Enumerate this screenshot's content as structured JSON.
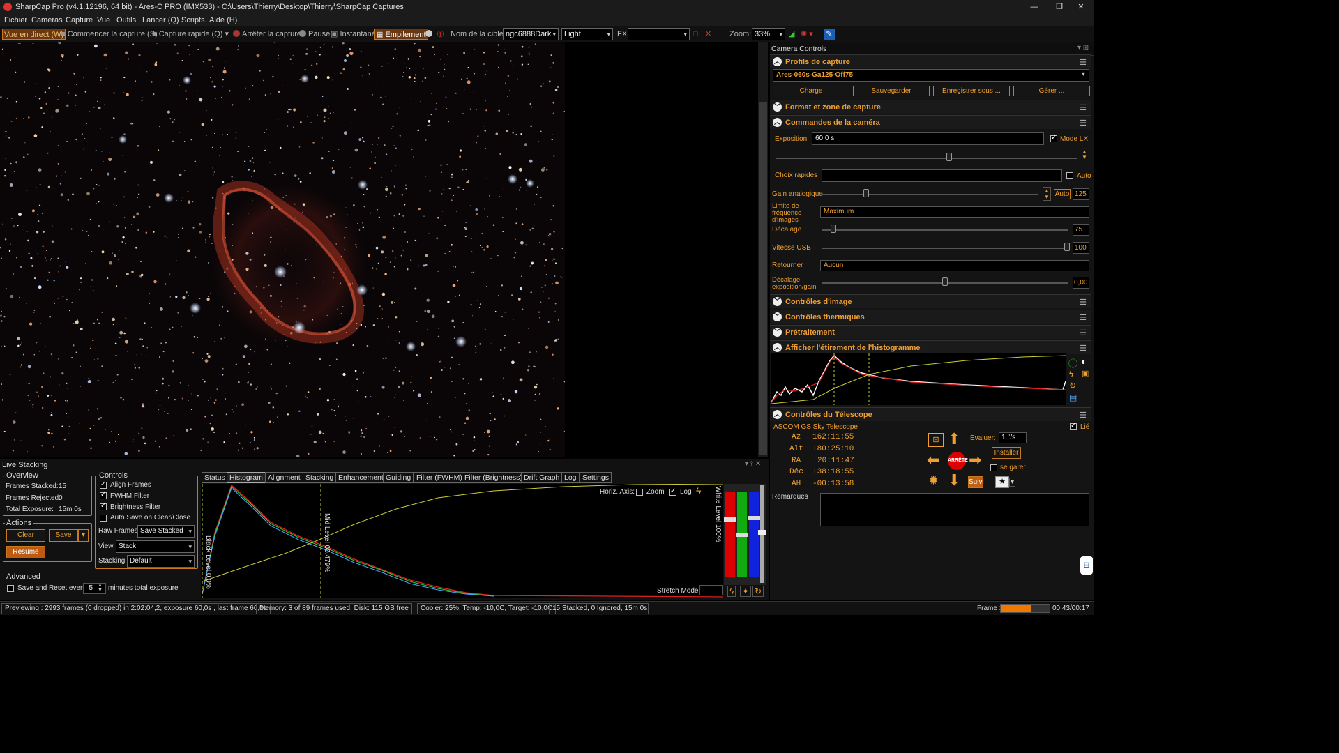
{
  "window": {
    "title": "SharpCap Pro (v4.1.12196, 64 bit) - Ares-C PRO (IMX533)  - C:\\Users\\Thierry\\Desktop\\Thierry\\SharpCap Captures"
  },
  "menu": [
    "Fichier",
    "Cameras",
    "Capture",
    "Vue",
    "Outils",
    "Lancer (Q)",
    "Scripts",
    "Aide (H)"
  ],
  "toolbar": {
    "live_view": "Vue en direct (W)",
    "start_capture": "Commencer la capture (S)",
    "quick_capture": "Capture rapide (Q)",
    "stop_capture": "Arrêter la capture",
    "pause": "Pause",
    "snapshot": "Instantané",
    "stacking": "Empilement",
    "target_label": "Nom de la cible:",
    "target_value": "ngc6888Dark",
    "frame_type": "Light",
    "fx_label": "FX",
    "zoom_label": "Zoom:",
    "zoom_value": "33%"
  },
  "camera_controls": {
    "header": "Camera Controls",
    "profiles_title": "Profils de capture",
    "profile_value": "Ares-060s-Ga125-Off75",
    "profile_buttons": [
      "Charge",
      "Sauvegarder",
      "Enregistrer sous ...",
      "Gérer ..."
    ],
    "format_title": "Format et zone de capture",
    "camera_cmd_title": "Commandes de la caméra",
    "exposure_label": "Exposition",
    "exposure_value": "60,0 s",
    "lx_mode": "Mode LX",
    "quick_choice": "Choix rapides",
    "auto": "Auto",
    "gain_label": "Gain analogique",
    "gain_auto": "Auto",
    "gain_value": "125",
    "framerate_label": "Limite de fréquence d'images",
    "framerate_value": "Maximum",
    "offset_label": "Décalage",
    "offset_value": "75",
    "usb_label": "Vitesse USB",
    "usb_value": "100",
    "flip_label": "Retourner",
    "flip_value": "Aucun",
    "expgain_offset_label": "Décalage exposition/gain",
    "expgain_offset_value": "0,00",
    "image_controls_title": "Contrôles d'image",
    "thermal_title": "Contrôles thermiques",
    "preprocess_title": "Prétraitement",
    "histogram_title": "Afficher l'étirement de l'histogramme",
    "telescope_title": "Contrôles du Télescope",
    "telescope_name": "ASCOM GS Sky Telescope",
    "linked": "Lié",
    "az_label": "Az",
    "az_value": "162:11:55",
    "alt_label": "Alt",
    "alt_value": "+80:25:10",
    "ra_label": "RA",
    "ra_value": "20:11:47",
    "dec_label": "Déc",
    "dec_value": "+38:18:55",
    "ha_label": "AH",
    "ha_value": "-00:13:58",
    "rate_label": "Évaluer:",
    "rate_value": "1 °/s",
    "install_btn": "Installer",
    "park_label": "se garer",
    "stop_btn": "ARRÊTE",
    "track_btn": "Suivi",
    "remarks_label": "Remarques"
  },
  "live_stacking": {
    "title": "Live Stacking",
    "overview_title": "Overview",
    "frames_stacked_label": "Frames Stacked:",
    "frames_stacked": "15",
    "frames_rejected_label": "Frames Rejected:",
    "frames_rejected": "0",
    "total_exposure_label": "Total Exposure:",
    "total_exposure": "15m 0s",
    "actions_title": "Actions",
    "clear_btn": "Clear",
    "save_btn": "Save",
    "resume_btn": "Resume",
    "advanced_title": "Advanced",
    "save_reset_label": "Save and Reset every",
    "save_reset_value": "5",
    "minutes_label": "minutes total exposure",
    "controls_title": "Controls",
    "align_frames": "Align Frames",
    "fwhm_filter": "FWHM Filter",
    "brightness_filter": "Brightness Filter",
    "auto_save": "Auto Save on Clear/Close",
    "raw_frames_label": "Raw Frames",
    "raw_frames_value": "Save Stacked",
    "view_label": "View",
    "view_value": "Stack",
    "stacking_label": "Stacking",
    "stacking_value": "Default",
    "tabs": [
      "Status",
      "Histogram",
      "Alignment",
      "Stacking",
      "Enhancement",
      "Guiding",
      "Filter (FWHM)",
      "Filter (Brightness)",
      "Drift Graph",
      "Log",
      "Settings"
    ],
    "horiz_axis": "Horiz. Axis:",
    "zoom": "Zoom",
    "log": "Log",
    "black_level": "Black Level 0.0%",
    "mid_level": "Mid Level 00.479%",
    "white_level": "White Level 100%",
    "stretch_mode": "Stretch Mode"
  },
  "status": {
    "previewing": "Previewing : 2993 frames (0 dropped) in 2:02:04,2, exposure 60,0s , last frame 60,0s",
    "memory": "Memory: 3 of 89 frames used, Disk: 115 GB free",
    "cooler": "Cooler: 25%, Temp: -10,0C, Target: -10,0C",
    "stacked": "15 Stacked, 0 Ignored, 15m 0s",
    "frame_label": "Frame :",
    "frame_progress": "00:43/00:17",
    "frame_fraction": 0.62
  }
}
